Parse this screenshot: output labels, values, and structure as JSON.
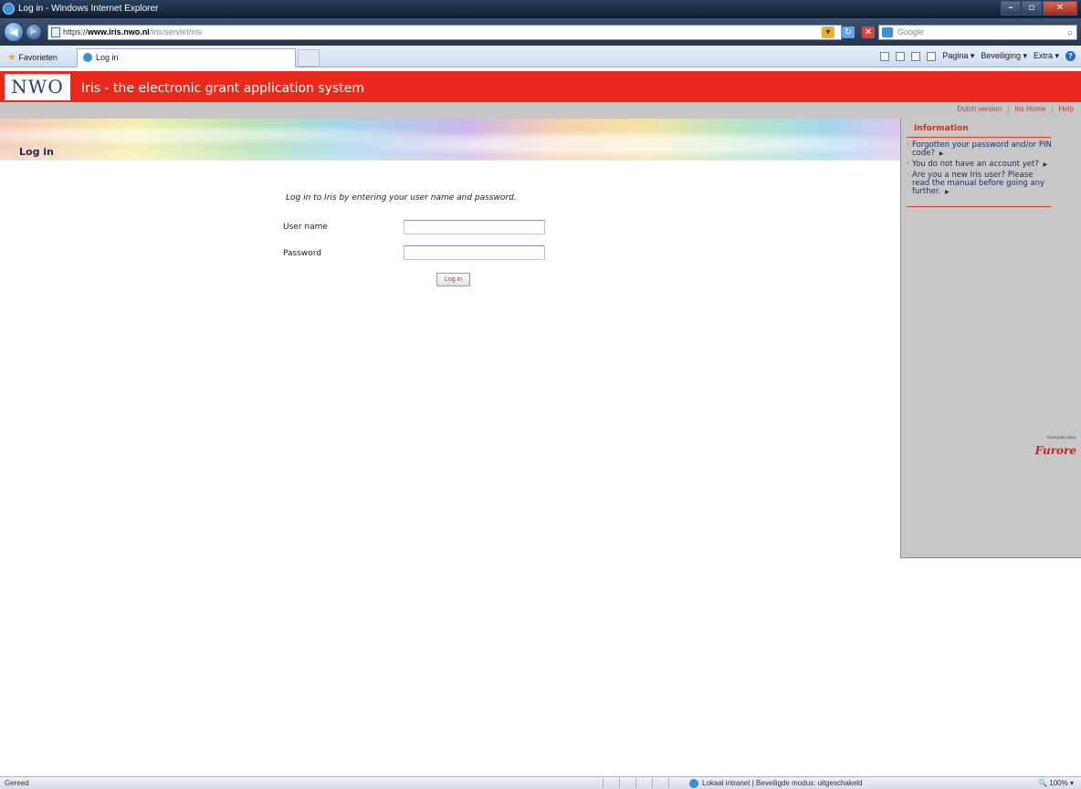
{
  "browser": {
    "window_title": "Log in - Windows Internet Explorer",
    "url_prefix": "https://",
    "url_host": "www.iris.nwo.nl",
    "url_path": "/iris/servlet/iris",
    "search_placeholder": "Google",
    "favorites_label": "Favorieten",
    "tab_label": "Log in",
    "command_bar": {
      "page": "Pagina ▾",
      "security": "Beveiliging ▾",
      "tools": "Extra ▾"
    },
    "status_text": "Gereed",
    "zone_text": "Lokaal intranet | Beveiligde modus: uitgeschakeld",
    "zoom": "100%"
  },
  "header": {
    "logo": "NWO",
    "site_title": "Iris - the electronic grant application system",
    "links": [
      "Dutch version",
      "Iris Home",
      "Help"
    ]
  },
  "banner": {
    "page_heading": "Log in"
  },
  "login": {
    "intro": "Log in to Iris by entering your user name and password.",
    "username_label": "User name",
    "password_label": "Password",
    "username_value": "",
    "password_value": "",
    "button_label": "Log in"
  },
  "sidebar": {
    "heading": "Information",
    "items": [
      "Forgotten your password and/or PIN code?",
      "You do not have an account yet?",
      "Are you a new Iris user? Please read the manual before going any further."
    ],
    "credit_small": "Gemaakt door",
    "credit_brand": "Furore"
  },
  "colors": {
    "brand_red": "#e8291c",
    "navy": "#1e2a5a",
    "sidebar_grey": "#c8c8c8"
  }
}
